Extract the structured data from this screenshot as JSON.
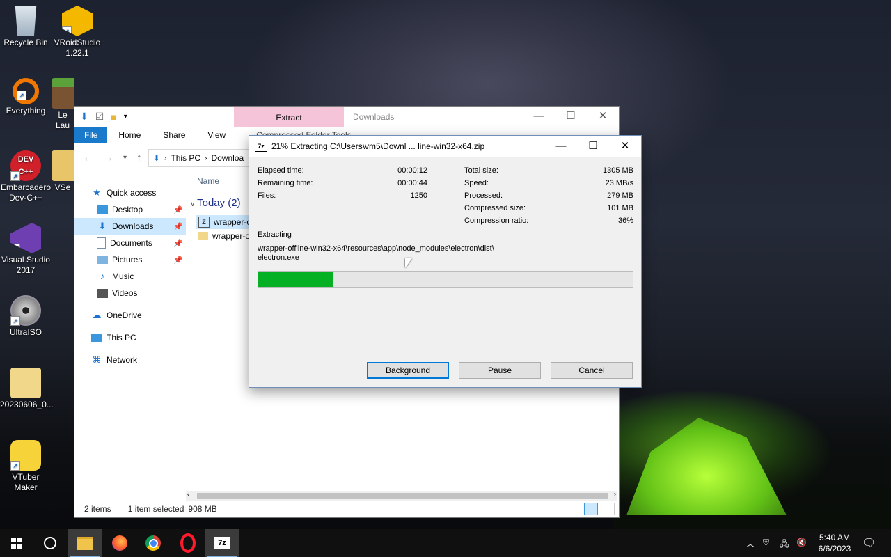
{
  "desktop": {
    "icons": [
      {
        "label": "Recycle Bin"
      },
      {
        "label": "VRoidStudio 1.22.1"
      },
      {
        "label": "Everything"
      },
      {
        "label": "Le Lau"
      },
      {
        "label": "Embarcadero Dev-C++"
      },
      {
        "label": "VSe"
      },
      {
        "label": "Visual Studio 2017"
      },
      {
        "label": "UltraISO"
      },
      {
        "label": "20230606_0..."
      },
      {
        "label": "VTuber Maker"
      }
    ]
  },
  "explorer": {
    "context_tab": "Extract",
    "context_group": "Compressed Folder Tools",
    "title": "Downloads",
    "ribbon_tabs": [
      "File",
      "Home",
      "Share",
      "View"
    ],
    "address": {
      "this_pc": "This PC",
      "downloads": "Downloa"
    },
    "nav": {
      "quick_access": "Quick access",
      "desktop": "Desktop",
      "downloads": "Downloads",
      "documents": "Documents",
      "pictures": "Pictures",
      "music": "Music",
      "videos": "Videos",
      "onedrive": "OneDrive",
      "this_pc": "This PC",
      "network": "Network"
    },
    "column_name": "Name",
    "group": "Today (2)",
    "files": [
      {
        "name": "wrapper-o"
      },
      {
        "name": "wrapper-o"
      }
    ],
    "status": {
      "items": "2 items",
      "selected": "1 item selected",
      "size": "908 MB"
    }
  },
  "dialog": {
    "app_icon": "7z",
    "title": "21% Extracting C:\\Users\\vm5\\Downl ... line-win32-x64.zip",
    "left_stats": [
      {
        "label": "Elapsed time:",
        "value": "00:00:12"
      },
      {
        "label": "Remaining time:",
        "value": "00:00:44"
      },
      {
        "label": "Files:",
        "value": "1250"
      }
    ],
    "right_stats": [
      {
        "label": "Total size:",
        "value": "1305 MB"
      },
      {
        "label": "Speed:",
        "value": "23 MB/s"
      },
      {
        "label": "Processed:",
        "value": "279 MB"
      },
      {
        "label": "Compressed size:",
        "value": "101 MB"
      },
      {
        "label": "Compression ratio:",
        "value": "36%"
      }
    ],
    "action_label": "Extracting",
    "path_line1": "wrapper-offline-win32-x64\\resources\\app\\node_modules\\electron\\dist\\",
    "path_line2": "electron.exe",
    "progress_fraction": 0.2,
    "buttons": {
      "background": "Background",
      "pause": "Pause",
      "cancel": "Cancel"
    }
  },
  "taskbar": {
    "time": "5:40 AM",
    "date": "6/6/2023"
  },
  "colors": {
    "progress": "#06b025",
    "accent": "#0078d7",
    "file_tab": "#1979ca",
    "context_tab": "#f6c4d8"
  }
}
